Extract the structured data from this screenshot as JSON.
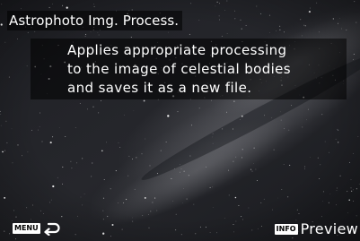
{
  "header": {
    "title": "Astrophoto Img. Process."
  },
  "description": {
    "lines": [
      "Applies appropriate processing",
      "to the image of celestial bodies",
      "and saves it as a new file."
    ]
  },
  "footer": {
    "menu_key": "MENU",
    "back_icon": "return-arrow-icon",
    "info_key": "INFO",
    "preview_label": "Preview"
  },
  "colors": {
    "sky_dark": "#17181c",
    "sky_mid": "#4a4c52",
    "panel": "#000000",
    "text": "#ffffff"
  }
}
